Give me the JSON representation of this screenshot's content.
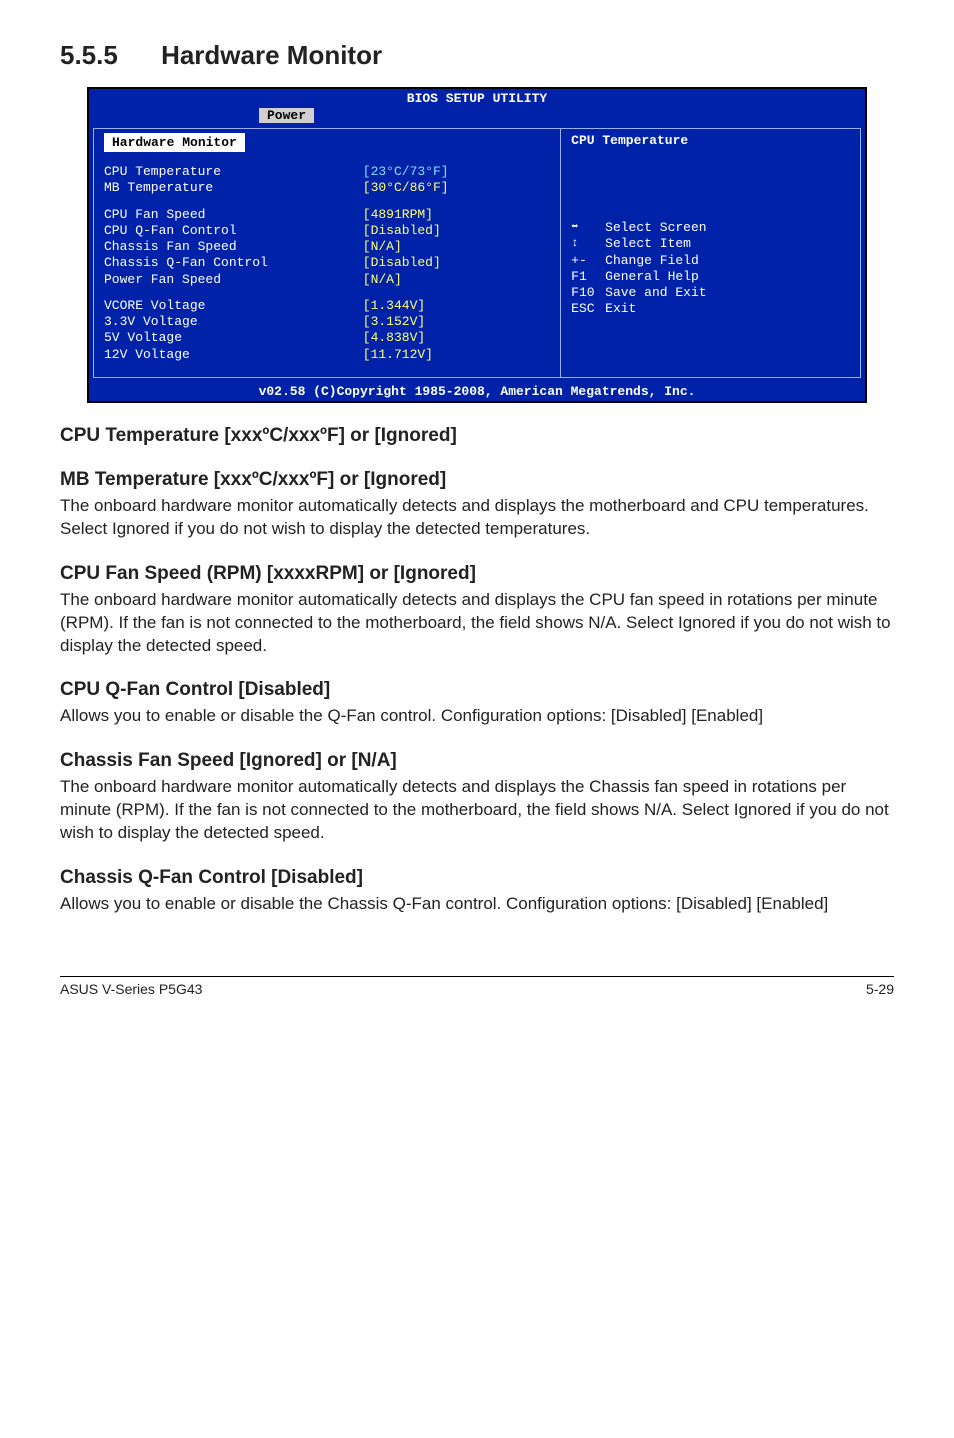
{
  "title": {
    "num": "5.5.5",
    "text": "Hardware Monitor"
  },
  "bios": {
    "header": "BIOS SETUP UTILITY",
    "tab": "Power",
    "panel_title": "Hardware Monitor",
    "rows": [
      {
        "label": "CPU Temperature",
        "value": "[23°C/73°F]",
        "labelClass": "",
        "valClass": "cyan"
      },
      {
        "label": "MB Temperature",
        "value": "[30°C/86°F]",
        "labelClass": "",
        "valClass": "yellow"
      }
    ],
    "rows2": [
      {
        "label": "CPU Fan Speed",
        "value": "[4891RPM]",
        "labelClass": "",
        "valClass": "yellow"
      },
      {
        "label": "CPU Q-Fan Control",
        "value": "[Disabled]",
        "labelClass": "",
        "valClass": "yellow"
      },
      {
        "label": "Chassis Fan Speed",
        "value": "[N/A]",
        "labelClass": "",
        "valClass": "yellow"
      },
      {
        "label": "Chassis Q-Fan Control",
        "value": "[Disabled]",
        "labelClass": "",
        "valClass": "yellow"
      },
      {
        "label": "Power Fan Speed",
        "value": "[N/A]",
        "labelClass": "",
        "valClass": "yellow"
      }
    ],
    "rows3": [
      {
        "label": "VCORE Voltage",
        "value": "[1.344V]",
        "labelClass": "",
        "valClass": "yellow"
      },
      {
        "label": "3.3V Voltage",
        "value": "[3.152V]",
        "labelClass": "",
        "valClass": "yellow"
      },
      {
        "label": "5V Voltage",
        "value": "[4.838V]",
        "labelClass": "",
        "valClass": "yellow"
      },
      {
        "label": "12V Voltage",
        "value": "[11.712V]",
        "labelClass": "",
        "valClass": "yellow"
      }
    ],
    "right_title": "CPU Temperature",
    "help": [
      {
        "sym": "⬌",
        "desc": "Select Screen"
      },
      {
        "sym": "↕",
        "desc": "Select Item"
      },
      {
        "sym": "+-",
        "desc": "Change Field"
      },
      {
        "sym": "F1",
        "desc": "General Help"
      },
      {
        "sym": "F10",
        "desc": "Save and Exit"
      },
      {
        "sym": "ESC",
        "desc": "Exit"
      }
    ],
    "footer": "v02.58 (C)Copyright 1985-2008, American Megatrends, Inc."
  },
  "sections": [
    {
      "heading": "CPU Temperature [xxxºC/xxxºF] or [Ignored]",
      "body": ""
    },
    {
      "heading": "MB Temperature [xxxºC/xxxºF] or [Ignored]",
      "body": "The onboard hardware monitor automatically detects and displays the motherboard and CPU temperatures. Select Ignored if you do not wish to display the detected temperatures."
    },
    {
      "heading": "CPU Fan Speed (RPM) [xxxxRPM] or [Ignored]",
      "body": "The onboard hardware monitor automatically detects and displays the CPU fan speed in rotations per minute (RPM). If the fan is not connected to the motherboard, the field shows N/A. Select Ignored if you do not wish to display the detected speed."
    },
    {
      "heading": "CPU Q-Fan Control [Disabled]",
      "body": "Allows you to enable or disable the Q-Fan control. Configuration options: [Disabled] [Enabled]"
    },
    {
      "heading": "Chassis Fan Speed [Ignored] or [N/A]",
      "body": "The onboard hardware monitor automatically detects and displays the Chassis fan speed in rotations per minute (RPM). If the fan is not connected to the motherboard, the field shows N/A. Select Ignored if you do not wish to display the detected speed."
    },
    {
      "heading": "Chassis Q-Fan Control [Disabled]",
      "body": "Allows you to enable or disable the Chassis Q-Fan control. Configuration options: [Disabled] [Enabled]"
    }
  ],
  "footer": {
    "left": "ASUS V-Series P5G43",
    "right": "5-29"
  }
}
